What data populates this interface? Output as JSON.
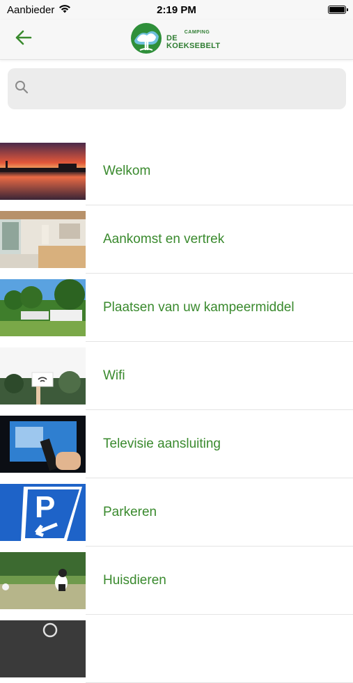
{
  "status_bar": {
    "carrier": "Aanbieder",
    "time": "2:19 PM"
  },
  "nav": {
    "logo_small": "CAMPING",
    "logo_big": "DE KOEKSEBELT",
    "back_icon": "back-arrow-icon"
  },
  "search": {
    "placeholder": "",
    "value": ""
  },
  "colors": {
    "accent": "#3a8a2e",
    "brand": "#2f7d32"
  },
  "items": [
    {
      "label": "Welkom",
      "image": "sunset-lake"
    },
    {
      "label": "Aankomst en vertrek",
      "image": "reception-interior"
    },
    {
      "label": "Plaatsen van uw kampeermiddel",
      "image": "camping-field"
    },
    {
      "label": "Wifi",
      "image": "wifi-sign"
    },
    {
      "label": "Televisie aansluiting",
      "image": "tv-remote"
    },
    {
      "label": "Parkeren",
      "image": "parking-sign"
    },
    {
      "label": "Huisdieren",
      "image": "dog-meadow"
    },
    {
      "label": "",
      "image": "dark-partial"
    }
  ]
}
